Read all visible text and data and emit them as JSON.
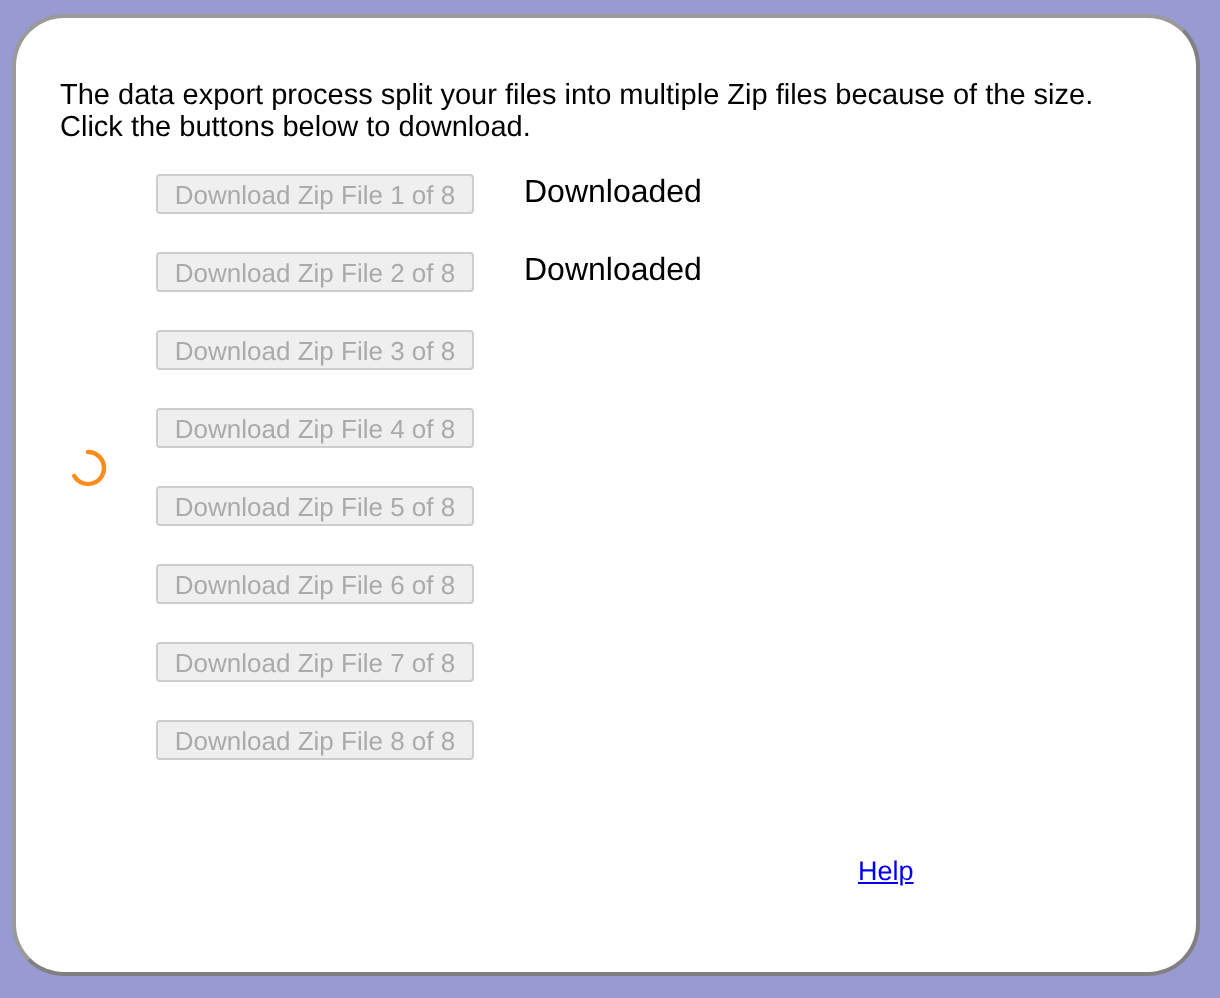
{
  "message": "The data export process split your files into multiple Zip files because of the size. Click the buttons below to download.",
  "loading": true,
  "files": [
    {
      "label": "Download Zip File 1 of 8",
      "disabled": true,
      "status": "Downloaded"
    },
    {
      "label": "Download Zip File 2 of 8",
      "disabled": true,
      "status": "Downloaded"
    },
    {
      "label": "Download Zip File 3 of 8",
      "disabled": true
    },
    {
      "label": "Download Zip File 4 of 8",
      "disabled": true
    },
    {
      "label": "Download Zip File 5 of 8",
      "disabled": true
    },
    {
      "label": "Download Zip File 6 of 8",
      "disabled": true
    },
    {
      "label": "Download Zip File 7 of 8",
      "disabled": true
    },
    {
      "label": "Download Zip File 8 of 8",
      "disabled": true
    }
  ],
  "help_link": "Help"
}
